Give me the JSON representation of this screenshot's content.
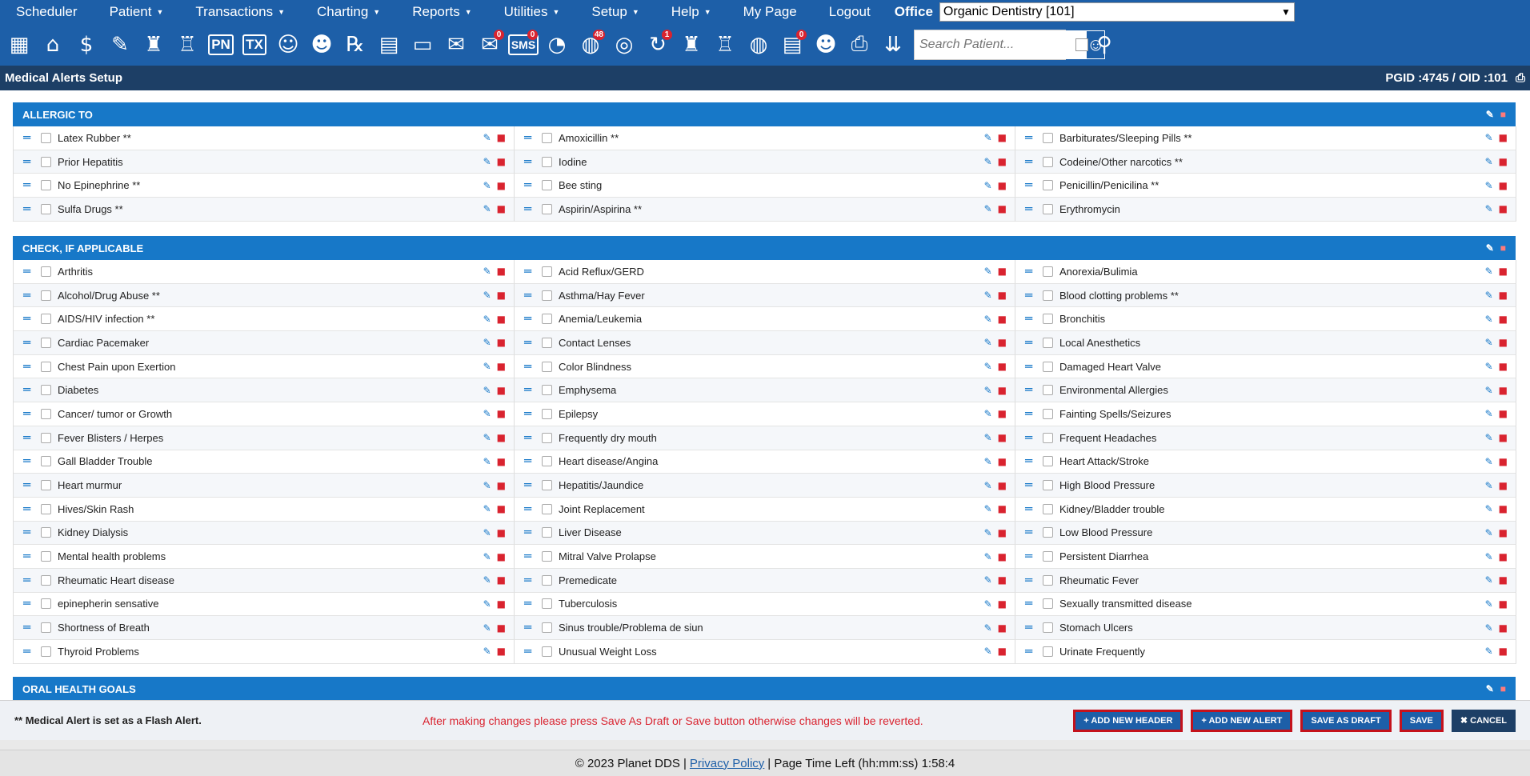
{
  "nav": {
    "menu": [
      {
        "label": "Scheduler",
        "caret": false
      },
      {
        "label": "Patient",
        "caret": true
      },
      {
        "label": "Transactions",
        "caret": true
      },
      {
        "label": "Charting",
        "caret": true
      },
      {
        "label": "Reports",
        "caret": true
      },
      {
        "label": "Utilities",
        "caret": true
      },
      {
        "label": "Setup",
        "caret": true
      },
      {
        "label": "Help",
        "caret": true
      },
      {
        "label": "My Page",
        "caret": false
      },
      {
        "label": "Logout",
        "caret": false
      }
    ],
    "office_label": "Office",
    "office_value": "Organic Dentistry [101]"
  },
  "toolbar": {
    "badges": {
      "messages": "0",
      "sms": "0",
      "alerts": "48",
      "refresh": "1",
      "claims": "0"
    },
    "sms_label": "SMS",
    "pn_label": "PN",
    "tx_label": "TX",
    "search_placeholder": "Search Patient..."
  },
  "page": {
    "title": "Medical Alerts Setup",
    "ids": "PGID :4745  /  OID :101"
  },
  "sections": [
    {
      "title": "ALLERGIC TO",
      "items": [
        "Latex Rubber **",
        "Amoxicillin **",
        "Barbiturates/Sleeping Pills **",
        "Prior Hepatitis",
        "Iodine",
        "Codeine/Other narcotics **",
        "No Epinephrine **",
        "Bee sting",
        "Penicillin/Penicilina **",
        "Sulfa Drugs **",
        "Aspirin/Aspirina **",
        "Erythromycin"
      ]
    },
    {
      "title": "CHECK, IF APPLICABLE",
      "items": [
        "Arthritis",
        "Acid Reflux/GERD",
        "Anorexia/Bulimia",
        "Alcohol/Drug Abuse **",
        "Asthma/Hay Fever",
        "Blood clotting problems **",
        "AIDS/HIV infection **",
        "Anemia/Leukemia",
        "Bronchitis",
        "Cardiac Pacemaker",
        "Contact Lenses",
        "Local Anesthetics",
        "Chest Pain upon Exertion",
        "Color Blindness",
        "Damaged Heart Valve",
        "Diabetes",
        "Emphysema",
        "Environmental Allergies",
        "Cancer/ tumor or Growth",
        "Epilepsy",
        "Fainting Spells/Seizures",
        "Fever Blisters / Herpes",
        "Frequently dry mouth",
        "Frequent Headaches",
        "Gall Bladder Trouble",
        "Heart disease/Angina",
        "Heart Attack/Stroke",
        "Heart murmur",
        "Hepatitis/Jaundice",
        "High Blood Pressure",
        "Hives/Skin Rash",
        "Joint Replacement",
        "Kidney/Bladder trouble",
        "Kidney Dialysis",
        "Liver Disease",
        "Low Blood Pressure",
        "Mental health problems",
        "Mitral Valve Prolapse",
        "Persistent Diarrhea",
        "Rheumatic Heart disease",
        "Premedicate",
        "Rheumatic Fever",
        "epinepherin sensative",
        "Tuberculosis",
        "Sexually transmitted disease",
        "Shortness of Breath",
        "Sinus trouble/Problema de siun",
        "Stomach Ulcers",
        "Thyroid Problems",
        "Unusual Weight Loss",
        "Urinate Frequently"
      ]
    },
    {
      "title": "ORAL HEALTH GOALS",
      "items": []
    }
  ],
  "footer": {
    "note": "** Medical Alert is set as a Flash Alert.",
    "warning": "After making changes please press Save As Draft or Save button otherwise changes will be reverted.",
    "add_header": "+ ADD NEW HEADER",
    "add_alert": "+ ADD NEW ALERT",
    "save_draft": "SAVE AS DRAFT",
    "save": "SAVE",
    "cancel": "✖ CANCEL"
  },
  "pagefoot": {
    "copyright": "© 2023 Planet DDS |",
    "privacy": "Privacy Policy",
    "time_left": "|  Page Time Left (hh:mm:ss) 1:58:4"
  }
}
